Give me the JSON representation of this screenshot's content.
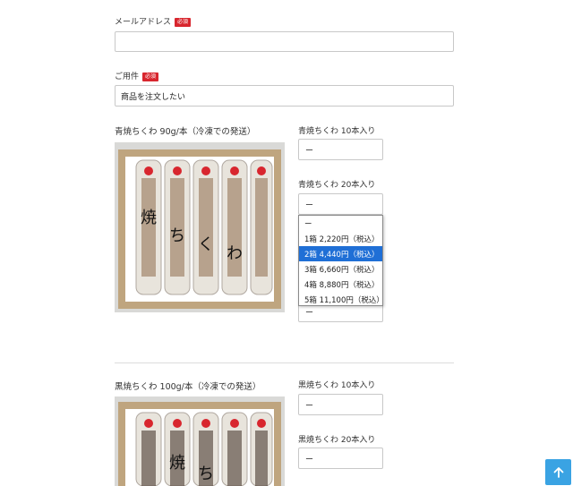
{
  "form": {
    "email": {
      "label": "メールアドレス",
      "required_badge": "必須",
      "value": ""
    },
    "subject": {
      "label": "ご用件",
      "required_badge": "必須",
      "value": "商品を注文したい"
    }
  },
  "products": [
    {
      "title": "青焼ちくわ 90g/本（冷凍での発送）",
      "options": [
        {
          "label": "青焼ちくわ 10本入り",
          "value": "ー"
        },
        {
          "label": "青焼ちくわ 20本入り",
          "value": "ー"
        },
        {
          "value": "ー"
        }
      ],
      "image_alt": "焼ちくわ"
    },
    {
      "title": "黒焼ちくわ 100g/本（冷凍での発送）",
      "options": [
        {
          "label": "黒焼ちくわ 10本入り",
          "value": "ー"
        },
        {
          "label": "黒焼ちくわ 20本入り",
          "value": "ー"
        }
      ],
      "image_alt": "焼ちくわ"
    }
  ],
  "dropdown": {
    "items": [
      {
        "label": "ー"
      },
      {
        "label": "1箱 2,220円（税込）"
      },
      {
        "label": "2箱 4,440円（税込）",
        "selected": true
      },
      {
        "label": "3箱 6,660円（税込）"
      },
      {
        "label": "4箱 8,880円（税込）"
      },
      {
        "label": "5箱 11,100円（税込）"
      }
    ],
    "highlight_color": "#1f6fd6"
  },
  "colors": {
    "required_badge": "#d8262e",
    "back_to_top": "#3aa3e3"
  },
  "back_to_top": {
    "icon": "arrow-up-icon"
  }
}
